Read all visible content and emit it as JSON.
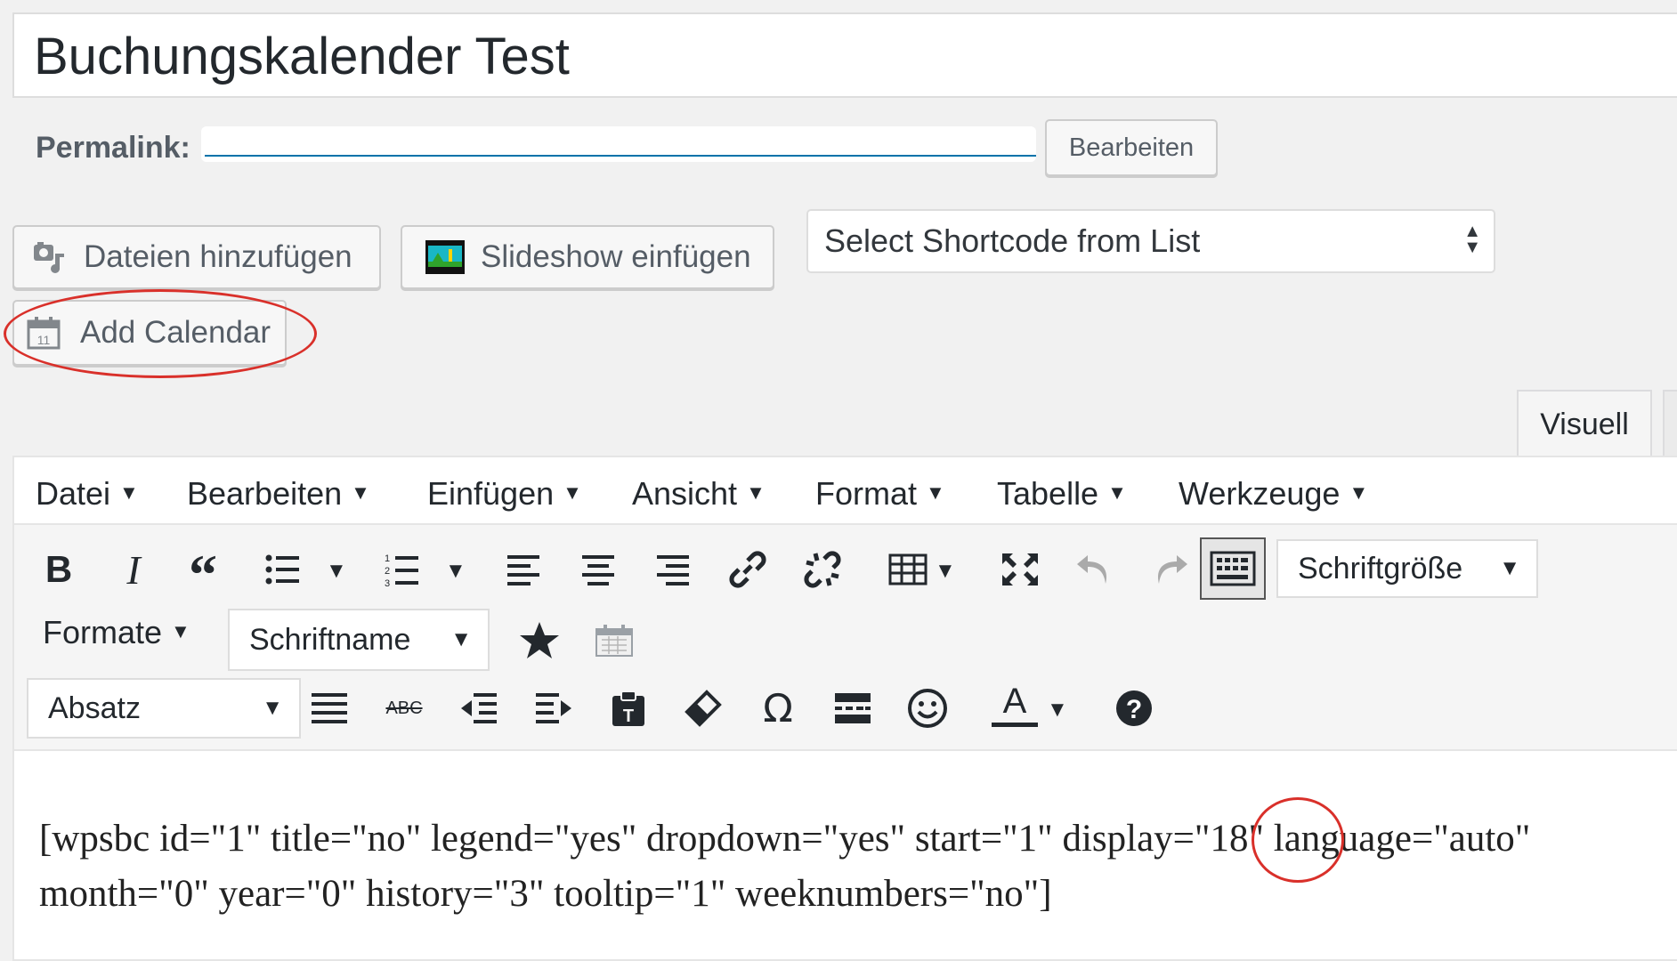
{
  "post": {
    "title": "Buchungskalender Test",
    "permalink_label": "Permalink:",
    "permalink_edit_label": "Bearbeiten"
  },
  "media_buttons": {
    "add_media": "Dateien hinzufügen",
    "slideshow": "Slideshow einfügen",
    "add_calendar": "Add Calendar",
    "shortcode_select": "Select Shortcode from List"
  },
  "editor_tabs": {
    "visual": "Visuell"
  },
  "menubar": [
    "Datei",
    "Bearbeiten",
    "Einfügen",
    "Ansicht",
    "Format",
    "Tabelle",
    "Werkzeuge"
  ],
  "toolbar": {
    "font_size": "Schriftgröße",
    "formats": "Formate",
    "font_family": "Schriftname",
    "block_format": "Absatz",
    "strike_label": "ABC",
    "bold_label": "B",
    "italic_label": "I",
    "text_color_label": "A",
    "omega_label": "Ω",
    "help_label": "?"
  },
  "icons": {
    "add_media": "media-icon",
    "slideshow": "slideshow-image-icon",
    "add_calendar": "calendar-icon"
  },
  "content": {
    "line1": "[wpsbc id=\"1\" title=\"no\" legend=\"yes\" dropdown=\"yes\" start=\"1\" display=\"18\" language=\"auto\"",
    "line2": "month=\"0\" year=\"0\" history=\"3\" tooltip=\"1\" weeknumbers=\"no\"]"
  },
  "colors": {
    "annotation": "#d9302a",
    "link": "#0073aa"
  }
}
